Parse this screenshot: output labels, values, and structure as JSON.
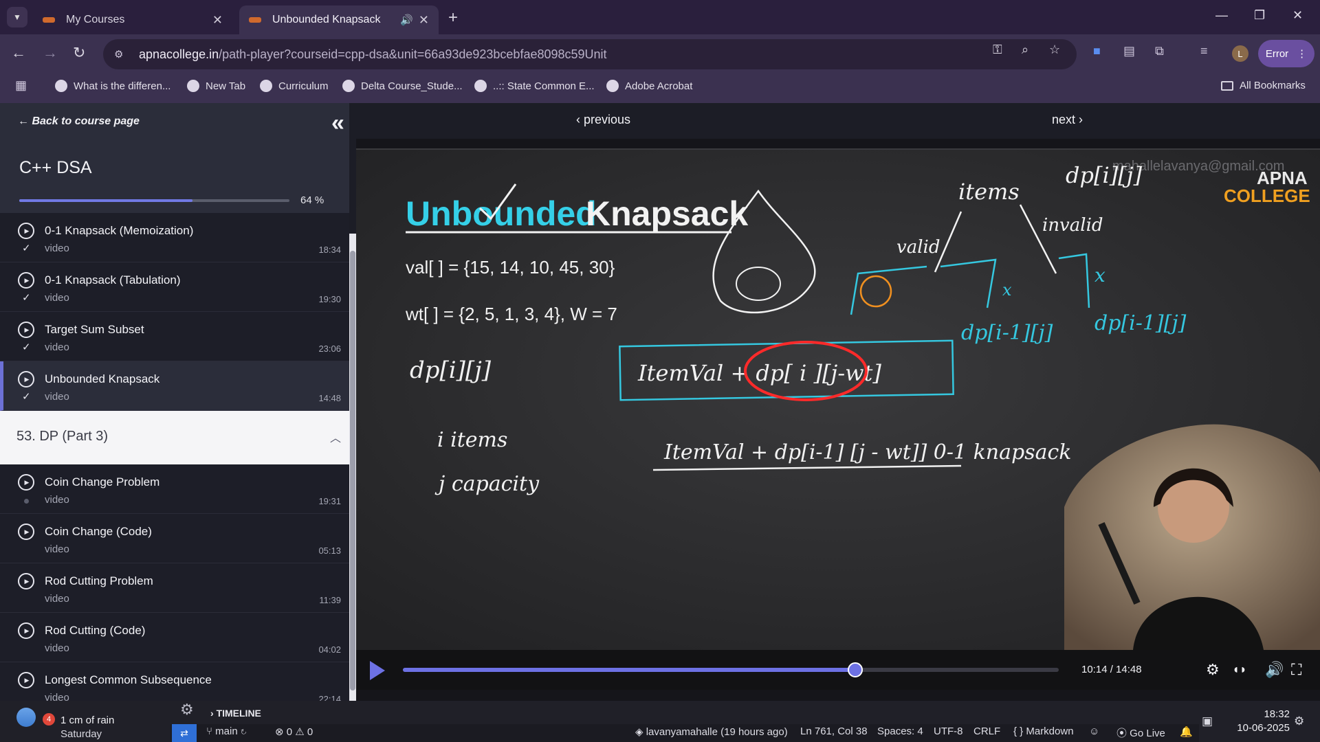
{
  "browser": {
    "tabs": [
      {
        "title": "My Courses"
      },
      {
        "title": "Unbounded Knapsack"
      }
    ],
    "url_host": "apnacollege.in",
    "url_path": "/path-player?courseid=cpp-dsa&unit=66a93de923bcebfae8098c59Unit",
    "error_label": "Error",
    "profile_initial": "L",
    "bookmarks": [
      "What is the differen...",
      "New Tab",
      "Curriculum",
      "Delta Course_Stude...",
      "..:: State Common E...",
      "Adobe Acrobat"
    ],
    "all_bookmarks": "All Bookmarks"
  },
  "sidebar": {
    "back_label": "Back to course page",
    "course_title": "C++ DSA",
    "progress_percent": 64,
    "progress_text": "64 %",
    "lessons_before": [
      {
        "name": "0-1 Knapsack (Memoization)",
        "kind": "video",
        "duration": "18:34",
        "status": "✓"
      },
      {
        "name": "0-1 Knapsack (Tabulation)",
        "kind": "video",
        "duration": "19:30",
        "status": "✓"
      },
      {
        "name": "Target Sum Subset",
        "kind": "video",
        "duration": "23:06",
        "status": "✓"
      },
      {
        "name": "Unbounded Knapsack",
        "kind": "video",
        "duration": "14:48",
        "status": "✓",
        "active": true
      }
    ],
    "section_title": "53. DP (Part 3)",
    "lessons_after": [
      {
        "name": "Coin Change Problem",
        "kind": "video",
        "duration": "19:31"
      },
      {
        "name": "Coin Change (Code)",
        "kind": "video",
        "duration": "05:13"
      },
      {
        "name": "Rod Cutting Problem",
        "kind": "video",
        "duration": "11:39"
      },
      {
        "name": "Rod Cutting (Code)",
        "kind": "video",
        "duration": "04:02"
      },
      {
        "name": "Longest Common Subsequence",
        "kind": "video",
        "duration": "22:14"
      }
    ]
  },
  "player": {
    "previous_label": "previous",
    "next_label": "next",
    "time_text": "10:14 / 14:48",
    "progress_fraction": 0.69,
    "board": {
      "title_word1": "Unbounded",
      "title_word2": "Knapsack",
      "val_line": "val[ ] = {15, 14, 10, 45, 30}",
      "wt_line": "wt[ ] = {2, 5, 1, 3, 4}, W = 7",
      "watermark": "mahallelavanya@gmail.com",
      "logo_line1": "APNA",
      "logo_line2": "COLLEGE",
      "hw_items": "items",
      "hw_dpij_top": "dp[i][j]",
      "hw_valid": "valid",
      "hw_invalid": "invalid",
      "hw_dp_i1j": "dp[i-1][j]",
      "hw_dp_i1j_b": "dp[i-1][j]",
      "hw_dpij": "dp[i][j]",
      "hw_formula1": "ItemVal + dp[ i ][j-wt]",
      "hw_formula2": "ItemVal + dp[i-1] [j - wt]]  0-1 knapsack",
      "hw_i_items": "i  items",
      "hw_j_capacity": "j  capacity",
      "hw_x": "x"
    }
  },
  "taskbar": {
    "weather_badge": "4",
    "weather_line1": "1 cm of rain",
    "weather_line2": "Saturday",
    "timeline": "TIMELINE",
    "branch": "main",
    "problems": "⊗ 0 ⚠ 0",
    "author": "lavanyamahalle (19 hours ago)",
    "position": "Ln 761, Col 38",
    "spaces": "Spaces: 4",
    "encoding": "UTF-8",
    "eol": "CRLF",
    "language": "{ } Markdown",
    "golive": "Go Live",
    "clock_time": "18:32",
    "clock_date": "10-06-2025"
  }
}
